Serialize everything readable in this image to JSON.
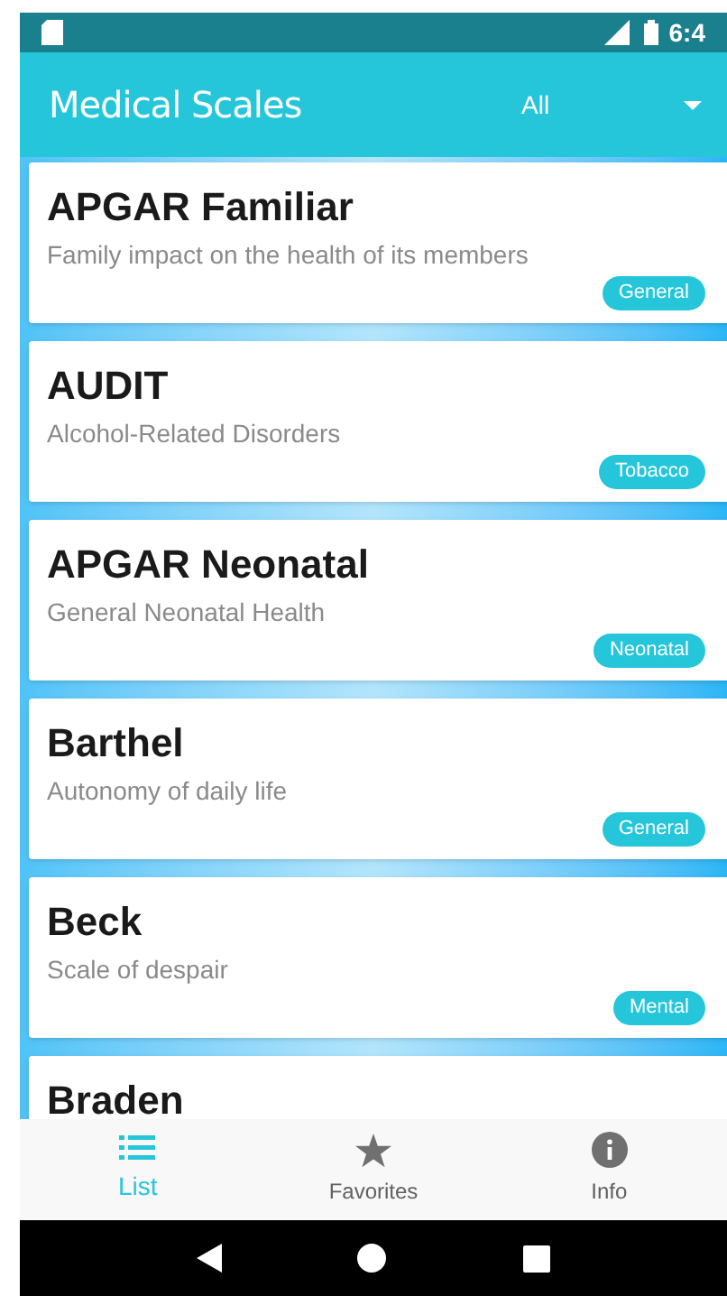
{
  "status_bar": {
    "time": "6:4"
  },
  "app_bar": {
    "title": "Medical Scales",
    "filter": "All"
  },
  "scales": [
    {
      "name": "APGAR Familiar",
      "description": "Family impact on the health of its members",
      "category": "General"
    },
    {
      "name": "AUDIT",
      "description": "Alcohol-Related Disorders",
      "category": "Tobacco"
    },
    {
      "name": "APGAR Neonatal",
      "description": "General Neonatal Health",
      "category": "Neonatal"
    },
    {
      "name": "Barthel",
      "description": "Autonomy of daily life",
      "category": "General"
    },
    {
      "name": "Beck",
      "description": "Scale of despair",
      "category": "Mental"
    },
    {
      "name": "Braden"
    }
  ],
  "bottom_nav": [
    {
      "kind": "list",
      "label": "List",
      "selected": true
    },
    {
      "kind": "star",
      "label": "Favorites",
      "selected": false
    },
    {
      "kind": "info",
      "label": "Info",
      "selected": false
    }
  ]
}
